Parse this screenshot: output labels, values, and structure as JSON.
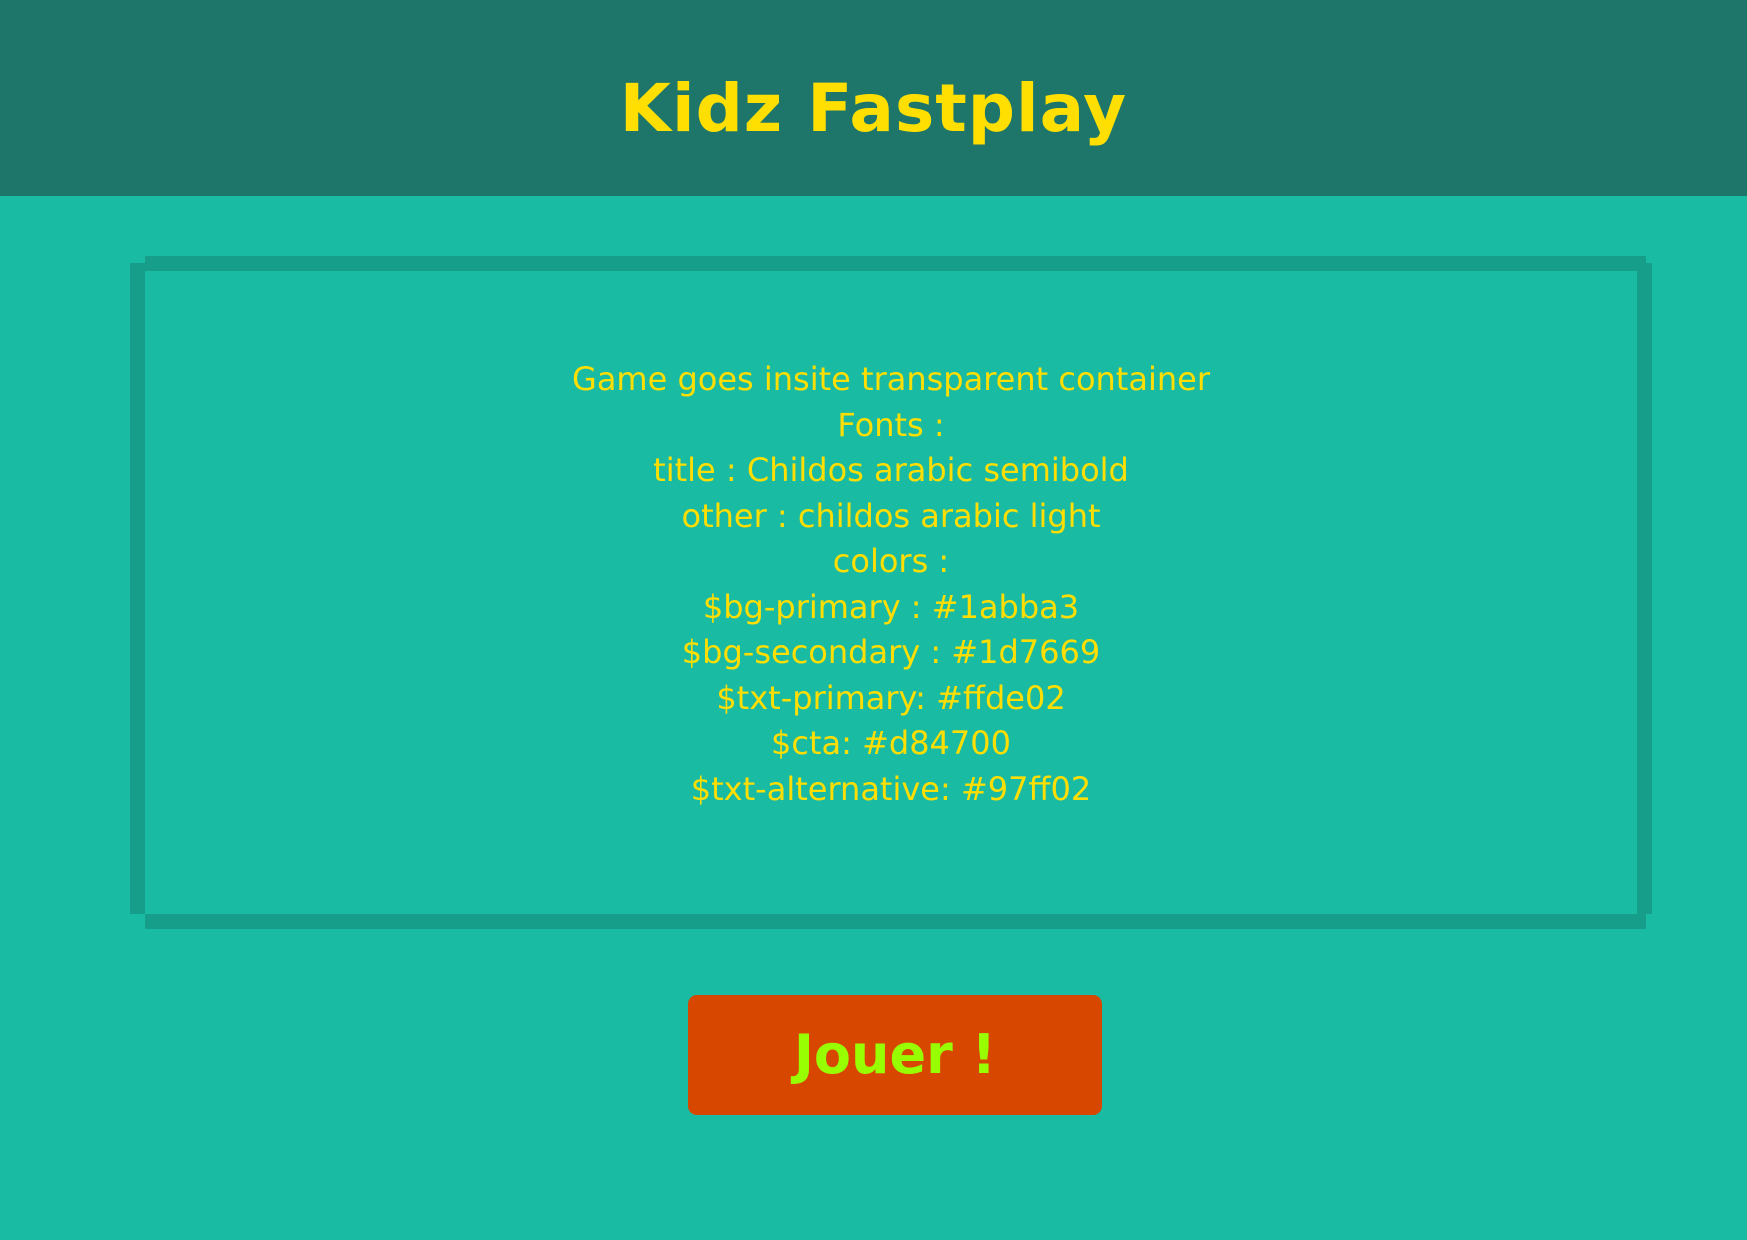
{
  "header": {
    "title": "Kidz Fastplay"
  },
  "game_container": {
    "lines": [
      "Game goes insite transparent container",
      "Fonts :",
      "title : Childos arabic semibold",
      "other : childos arabic light",
      "colors :",
      "$bg-primary : #1abba3",
      "$bg-secondary : #1d7669",
      "$txt-primary: #ffde02",
      "$cta: #d84700",
      "$txt-alternative: #97ff02"
    ]
  },
  "cta": {
    "label": "Jouer !"
  },
  "colors": {
    "bg_primary": "#1abba3",
    "bg_secondary": "#1d7669",
    "txt_primary": "#ffde02",
    "cta": "#d84700",
    "txt_alternative": "#97ff02"
  }
}
